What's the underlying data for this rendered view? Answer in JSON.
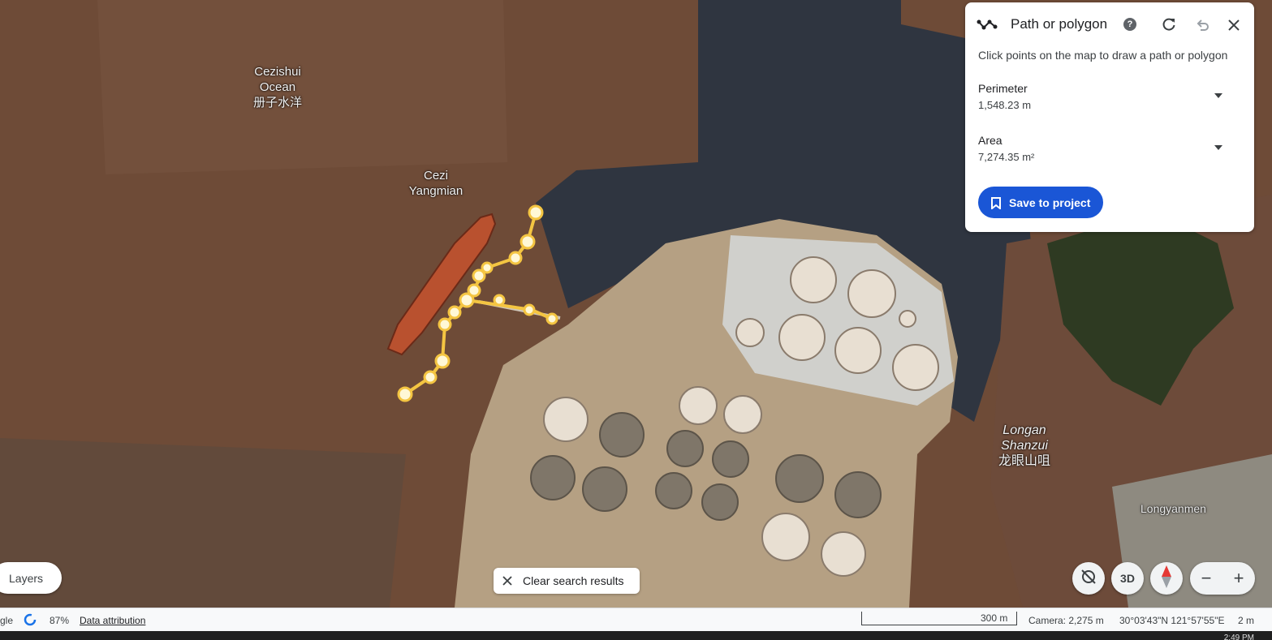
{
  "map": {
    "labels": {
      "cezishui_line1": "Cezishui",
      "cezishui_line2": "Ocean",
      "cezishui_cn": "册子水洋",
      "cezi_line1": "Cezi",
      "cezi_line2": "Yangmian",
      "longan_line1": "Longan",
      "longan_line2": "Shanzui",
      "longan_cn": "龙眼山咀",
      "longyanmen": "Longyanmen"
    },
    "colors": {
      "water": "#6b4a36",
      "dark_water": "#2e3440",
      "land": "#b9a68a",
      "path": "#f4c542"
    }
  },
  "panel": {
    "title": "Path or polygon",
    "icon": "path-polygon-icon",
    "instruction": "Click points on the map to draw a path or polygon",
    "perimeter_label": "Perimeter",
    "perimeter_value": "1,548.23 m",
    "area_label": "Area",
    "area_value": "7,274.35 m²",
    "save_label": "Save to project",
    "accent": "#1a56d6"
  },
  "controls": {
    "layers_label": "Layers",
    "clear_label": "Clear search results",
    "btn_3d": "3D",
    "zoom_out": "−",
    "zoom_in": "+"
  },
  "status": {
    "google": "gle",
    "loading": "87%",
    "attribution": "Data attribution",
    "scale": "300 m",
    "camera": "Camera: 2,275 m",
    "coords": "30°03'43\"N 121°57'55\"E",
    "elevation": "2 m"
  },
  "taskbar": {
    "clock": "2:49 PM"
  }
}
